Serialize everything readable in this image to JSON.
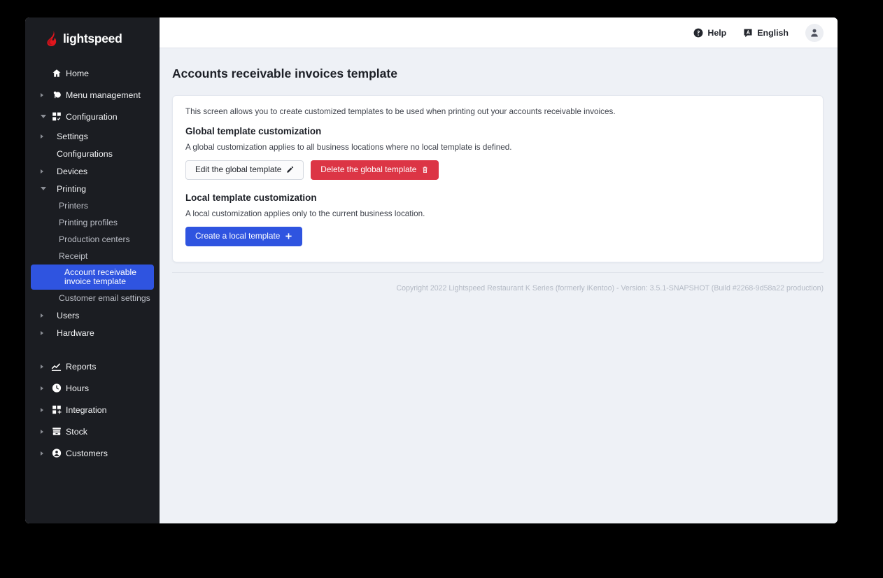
{
  "brand": {
    "logo_text": "lightspeed",
    "flame_color": "#e0161d",
    "sidebar_bg": "#1b1d22",
    "accent_blue": "#2f54e0",
    "danger_red": "#dc3545"
  },
  "topbar": {
    "help_label": "Help",
    "help_icon": "question-circle-icon",
    "language_label": "English",
    "language_icon": "translate-icon",
    "avatar_icon": "user-avatar-icon"
  },
  "sidebar": {
    "items": [
      {
        "label": "Home",
        "level": 1,
        "icon": "home-icon",
        "caret": "none",
        "active": false
      },
      {
        "label": "Menu management",
        "level": 1,
        "icon": "menu-management-icon",
        "caret": "collapsed",
        "active": false
      },
      {
        "label": "Configuration",
        "level": 1,
        "icon": "configuration-icon",
        "caret": "expanded",
        "active": false
      },
      {
        "label": "Settings",
        "level": 2,
        "icon": "none",
        "caret": "collapsed",
        "active": false
      },
      {
        "label": "Configurations",
        "level": 2,
        "icon": "none",
        "caret": "none",
        "active": false
      },
      {
        "label": "Devices",
        "level": 2,
        "icon": "none",
        "caret": "collapsed",
        "active": false
      },
      {
        "label": "Printing",
        "level": 2,
        "icon": "none",
        "caret": "expanded",
        "active": false
      },
      {
        "label": "Printers",
        "level": 3,
        "icon": "none",
        "caret": "none",
        "active": false
      },
      {
        "label": "Printing profiles",
        "level": 3,
        "icon": "none",
        "caret": "none",
        "active": false
      },
      {
        "label": "Production centers",
        "level": 3,
        "icon": "none",
        "caret": "none",
        "active": false
      },
      {
        "label": "Receipt",
        "level": 3,
        "icon": "none",
        "caret": "none",
        "active": false
      },
      {
        "label": "Account receivable invoice template",
        "level": 3,
        "icon": "none",
        "caret": "none",
        "active": true
      },
      {
        "label": "Customer email settings",
        "level": 3,
        "icon": "none",
        "caret": "none",
        "active": false
      },
      {
        "label": "Users",
        "level": 2,
        "icon": "none",
        "caret": "collapsed",
        "active": false
      },
      {
        "label": "Hardware",
        "level": 2,
        "icon": "none",
        "caret": "collapsed",
        "active": false
      },
      {
        "label": "Reports",
        "level": 1,
        "icon": "reports-icon",
        "caret": "collapsed",
        "active": false
      },
      {
        "label": "Hours",
        "level": 1,
        "icon": "clock-icon",
        "caret": "collapsed",
        "active": false
      },
      {
        "label": "Integration",
        "level": 1,
        "icon": "integration-icon",
        "caret": "collapsed",
        "active": false
      },
      {
        "label": "Stock",
        "level": 1,
        "icon": "stock-icon",
        "caret": "collapsed",
        "active": false
      },
      {
        "label": "Customers",
        "level": 1,
        "icon": "customers-icon",
        "caret": "collapsed",
        "active": false
      }
    ]
  },
  "page": {
    "title": "Accounts receivable invoices template",
    "intro": "This screen allows you to create customized templates to be used when printing out your accounts receivable invoices.",
    "global_section": {
      "title": "Global template customization",
      "description": "A global customization applies to all business locations where no local template is defined.",
      "edit_button": "Edit the global template",
      "edit_icon": "pencil-icon",
      "delete_button": "Delete the global template",
      "delete_icon": "trash-icon"
    },
    "local_section": {
      "title": "Local template customization",
      "description": "A local customization applies only to the current business location.",
      "create_button": "Create a local template",
      "create_icon": "plus-icon"
    }
  },
  "footer": {
    "copyright": "Copyright 2022 Lightspeed Restaurant K Series (formerly iKentoo) - Version: 3.5.1-SNAPSHOT (Build #2268-9d58a22 production)"
  }
}
